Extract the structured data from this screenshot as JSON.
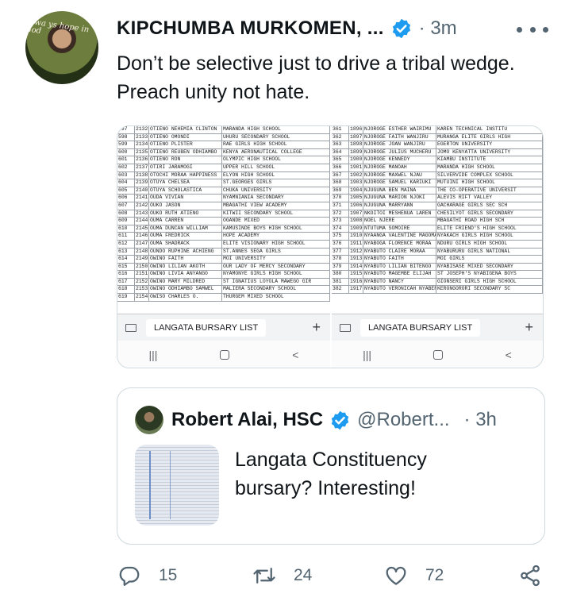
{
  "tweet": {
    "author_name": "KIPCHUMBA MURKOMEN, ...",
    "time": "· 3m",
    "avatar_caption": "Alwa ys  hope  in  God",
    "text": "Don’t be selective just to drive a tribal wedge. Preach unity not hate.",
    "accent_color": "#1d9bf0"
  },
  "media": {
    "left_sheet": {
      "rows": [
        [
          "597",
          "2132",
          "OTIENO NEHEMIA CLINTON",
          "MARANDA HIGH SCHOOL"
        ],
        [
          "598",
          "2133",
          "OTIENO OMONDI",
          "UHURU SECONDARY SCHOOL"
        ],
        [
          "599",
          "2134",
          "OTIENO PLISTER",
          "RAE GIRLS HIGH SCHOOL"
        ],
        [
          "600",
          "2135",
          "OTIENO REUBEN ODHIAMBO",
          "KENYA AERONAUTICAL COLLEGE"
        ],
        [
          "601",
          "2136",
          "OTIENO RON",
          "OLYMPIC HIGH SCHOOL"
        ],
        [
          "602",
          "2137",
          "OTIRI JARAMOGI",
          "UPPER HILL SCHOOL"
        ],
        [
          "603",
          "2138",
          "OTOCHI MORAA HAPPINESS",
          "ELYON HIGH SCHOOL"
        ],
        [
          "604",
          "2139",
          "OTUYA CHELSEA",
          "ST.GEORGES GIRLS"
        ],
        [
          "605",
          "2140",
          "OTUYA SCHOLASTICA",
          "CHUKA UNIVERSITY"
        ],
        [
          "606",
          "2141",
          "OUDA VIVIAN",
          "NYAMNIANIA SECONDARY"
        ],
        [
          "607",
          "2142",
          "OUKO JASON",
          "MBAGATHI VIEW ACADEMY"
        ],
        [
          "608",
          "2143",
          "OUKO RUTH ATIENO",
          "KITWII SECONDARY SCHOOL"
        ],
        [
          "609",
          "2144",
          "OUMA CARREN",
          "OGANDE MIXED"
        ],
        [
          "610",
          "2145",
          "OUMA DUNCAN WILLIAM",
          "KAMUSINDE BOYS HIGH SCHOOL"
        ],
        [
          "611",
          "2146",
          "OUMA FREDRICK",
          "HOPE ACADEMY"
        ],
        [
          "612",
          "2147",
          "OUMA SHADRACK",
          "ELITE VISIONARY HIGH SCHOOL"
        ],
        [
          "613",
          "2148",
          "OUNDO RUPHINE ACHIENG",
          "ST.ANNES SEGA GIRLS"
        ],
        [
          "614",
          "2149",
          "OWINO FAITH",
          "MOI UNIVERSITY"
        ],
        [
          "615",
          "2150",
          "OWINO LILIAN AKOTH",
          "OUR LADY OF MERCY SECONDARY"
        ],
        [
          "616",
          "2151",
          "OWINO LIVIA ANYANGO",
          "NYAMONYE GIRLS HIGH SCHOOL"
        ],
        [
          "617",
          "2152",
          "OWINO MARY MILDRED",
          "ST IGNATIUS LOYOLA MAWEGO GIR"
        ],
        [
          "618",
          "2153",
          "OWINO ODHIAMBO SAMWEL",
          "MALIERA SECONDARY SCHOOL"
        ],
        [
          "619",
          "2154",
          "OWISO CHARLES O.",
          "THURGEM MIXED SCHOOL"
        ]
      ],
      "tab_label": "LANGATA BURSARY LIST",
      "tab_plus": "+"
    },
    "right_sheet": {
      "rows": [
        [
          "361",
          "1896",
          "NJOROGE ESTHER WAIRIMU",
          "KAREN TECHNICAL INSTITU"
        ],
        [
          "362",
          "1897",
          "NJOROGE FAITH WANJIRU",
          "MURANGA ELITE GIRLS HIGH"
        ],
        [
          "363",
          "1898",
          "NJOROGE JOAN WANJIRU",
          "EGERTON UNIVERSITY"
        ],
        [
          "364",
          "1899",
          "NJOROGE JULIUS MUCHERU",
          "JOMO KENYATTA UNIVERSITY"
        ],
        [
          "365",
          "1900",
          "NJOROGE KENNEDY",
          "KIAMBU INSTITUTE"
        ],
        [
          "366",
          "1901",
          "NJOROGE MANOAH",
          "MARANDA HIGH SCHOOL"
        ],
        [
          "367",
          "1902",
          "NJOROGE MAXWEL NJAU",
          "SILVERVIDE COMPLEX SCHOOL"
        ],
        [
          "368",
          "1903",
          "NJOROGE SAMUEL KARIUKI",
          "MUTUINI HIGH SCHOOL"
        ],
        [
          "369",
          "1904",
          "NJUGUNA BEN MAINA",
          "THE CO-OPERATIVE UNIVERSIT"
        ],
        [
          "370",
          "1905",
          "NJUGUNA MARION NJOKI",
          "ALEVIS RIFT VALLEY"
        ],
        [
          "371",
          "1906",
          "NJUGUNA MARRYANN",
          "GACHARAGE GIRLS SEC SCH"
        ],
        [
          "372",
          "1907",
          "NKOITOI MESHENUA LAREN",
          "CHESILYOT GIRLS SECONDARY"
        ],
        [
          "373",
          "1908",
          "NOEL NJERE",
          "MBAGATHI ROAD HIGH SCH"
        ],
        [
          "374",
          "1909",
          "NTUTUMA SOMOIRE",
          "ELITE FRIEND'S HIGH SCHOOL"
        ],
        [
          "375",
          "1910",
          "NYAANGA VALENTINE MAGOMA",
          "NYAKACH GIRLS HIGH SCHOOL"
        ],
        [
          "376",
          "1911",
          "NYABOGA FLORENCE MORAA",
          "NDURU GIRLS HIGH SCHOOL"
        ],
        [
          "377",
          "1912",
          "NYABUTO CLAIRE MORAA",
          "NYABURURU GIRLS NATIONAL"
        ],
        [
          "378",
          "1913",
          "NYABUTO FAITH",
          "MOI GIRLS"
        ],
        [
          "379",
          "1914",
          "NYABUTO LILIAN BITENGO",
          "NYABISASE MIXED SECONDARY"
        ],
        [
          "380",
          "1915",
          "NYABUTO MAGEMBE ELIJAH",
          "ST JOSEPH'S NYABIGENA BOYS"
        ],
        [
          "381",
          "1916",
          "NYABUTO NANCY",
          "GIONSERI GIRLS HIGH SCHOOL"
        ],
        [
          "382",
          "1917",
          "NYABUTO VERONICAH NYABERI",
          "KERONGORORI SECONDARY SC"
        ]
      ],
      "tab_label": "LANGATA BURSARY LIST",
      "tab_plus": "+"
    },
    "nav": {
      "recents": "|||",
      "back": "<"
    }
  },
  "quote": {
    "author_name": "Robert Alai, HSC",
    "handle": "@Robert...",
    "time": "· 3h",
    "text": "Langata Constituency bursary? Interesting!"
  },
  "actions": {
    "reply_count": "15",
    "retweet_count": "24",
    "like_count": "72",
    "icons": [
      "reply-icon",
      "retweet-icon",
      "like-icon",
      "share-icon"
    ]
  }
}
